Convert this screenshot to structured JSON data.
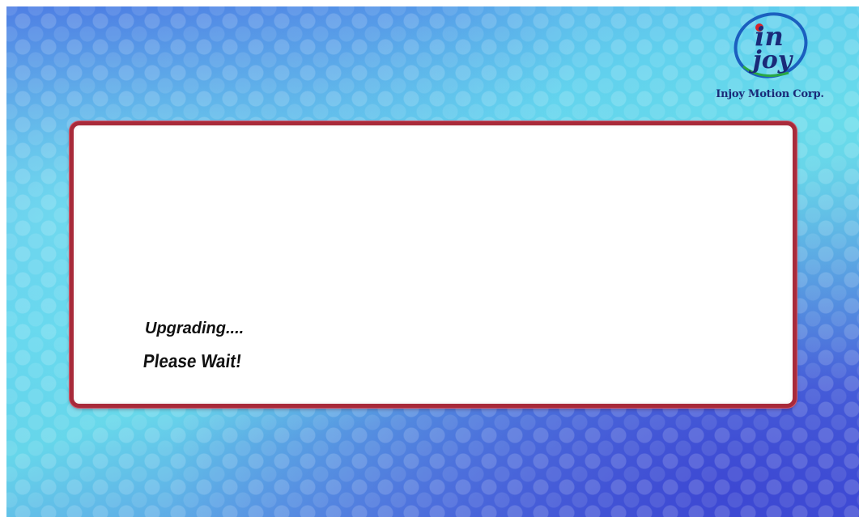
{
  "brand": {
    "logo_text_top": "in",
    "logo_text_bottom": "joy",
    "name": "Injoy Motion Corp.",
    "colors": {
      "ring": "#1b5fbf",
      "text": "#1a2a78",
      "green": "#2aa844",
      "red": "#d8232a"
    }
  },
  "dialog": {
    "status_text": "Upgrading....",
    "hint_text": "Please Wait!",
    "border_color": "#a82a3a"
  },
  "background": {
    "accent_colors": [
      "#5cc9ee",
      "#3f4fd6"
    ]
  }
}
